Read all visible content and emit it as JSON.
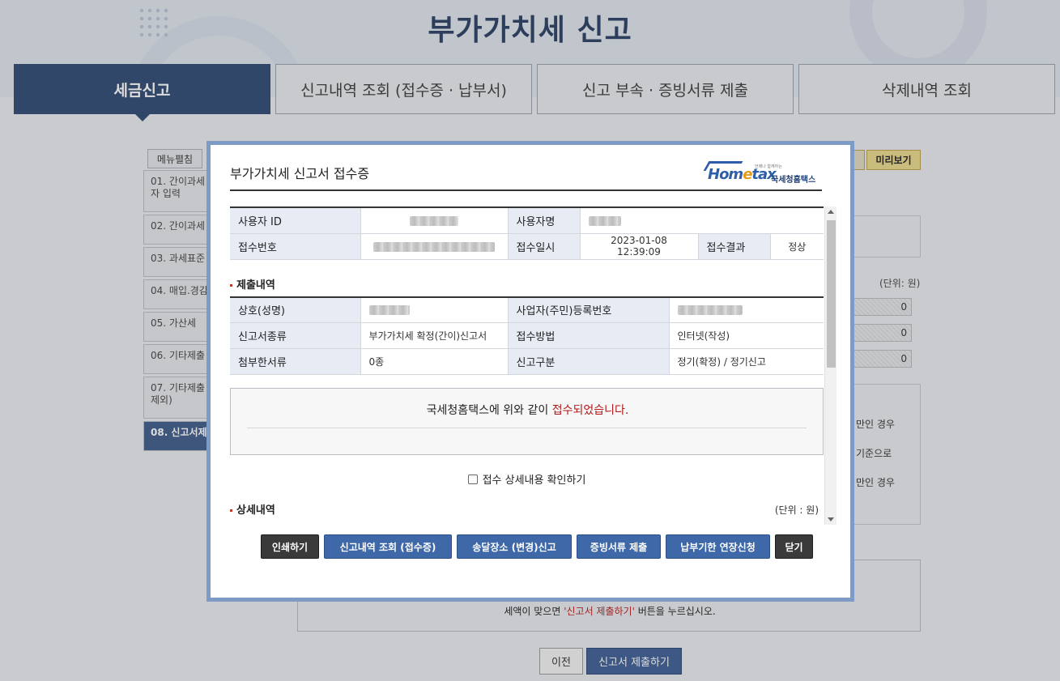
{
  "page": {
    "title": "부가가치세 신고",
    "tabs": [
      "세금신고",
      "신고내역 조회 (접수증 · 납부서)",
      "신고 부속 · 증빙서류 제출",
      "삭제내역 조회"
    ],
    "menu_toggle": "메뉴펼침",
    "side_menu": [
      "01. 간이과세자 입력",
      "02. 간이과세",
      "03. 과세표준",
      "04. 매입.경감",
      "05. 가산세",
      "06. 기타제출",
      "07. 기타제출 제외)",
      "08. 신고서제"
    ],
    "preview_label": "미리보기",
    "unit_label": "(단위: 원)",
    "field_values": [
      "0",
      "0",
      "0"
    ],
    "notes": [
      "만인 경우",
      "기준으로",
      "만인 경우"
    ],
    "footer_prefix": "세액이 맞으면 ",
    "footer_highlight": "'신고서 제출하기'",
    "footer_suffix": " 버튼을 누르십시오.",
    "prev_button": "이전",
    "submit_button": "신고서 제출하기"
  },
  "modal": {
    "title": "부가가치세 신고서 접수증",
    "logo_text": "Hometax",
    "logo_korean": "국세청홈택스",
    "logo_small": "언제나 함께하는",
    "info": {
      "user_id_label": "사용자 ID",
      "user_name_label": "사용자명",
      "receipt_no_label": "접수번호",
      "receipt_date_label": "접수일시",
      "receipt_date": "2023-01-08 12:39:09",
      "result_label": "접수결과",
      "result": "정상"
    },
    "submission": {
      "section": "제출내역",
      "company_label": "상호(성명)",
      "reg_no_label": "사업자(주민)등록번호",
      "form_type_label": "신고서종류",
      "form_type": "부가가치세 확정(간이)신고서",
      "method_label": "접수방법",
      "method": "인터넷(작성)",
      "attachments_label": "첨부한서류",
      "attachments": "0종",
      "category_label": "신고구분",
      "category": "정기(확정) / 정기신고"
    },
    "notice_prefix": "국세청홈택스에 위와 같이 ",
    "notice_highlight": "접수되었습니다.",
    "check_label": "접수 상세내용 확인하기",
    "detail_section": "상세내역",
    "detail_unit": "(단위 : 원)",
    "buttons": {
      "print": "인쇄하기",
      "history": "신고내역 조회 (접수증)",
      "address": "송달장소 (변경)신고",
      "evidence": "증빙서류 제출",
      "extension": "납부기한 연장신청",
      "close": "닫기"
    }
  },
  "colors": {
    "brand_navy": "#2f4a74",
    "button_blue": "#3e68a8",
    "highlight_red": "#b31717",
    "modal_frame": "#7e9bc6"
  }
}
